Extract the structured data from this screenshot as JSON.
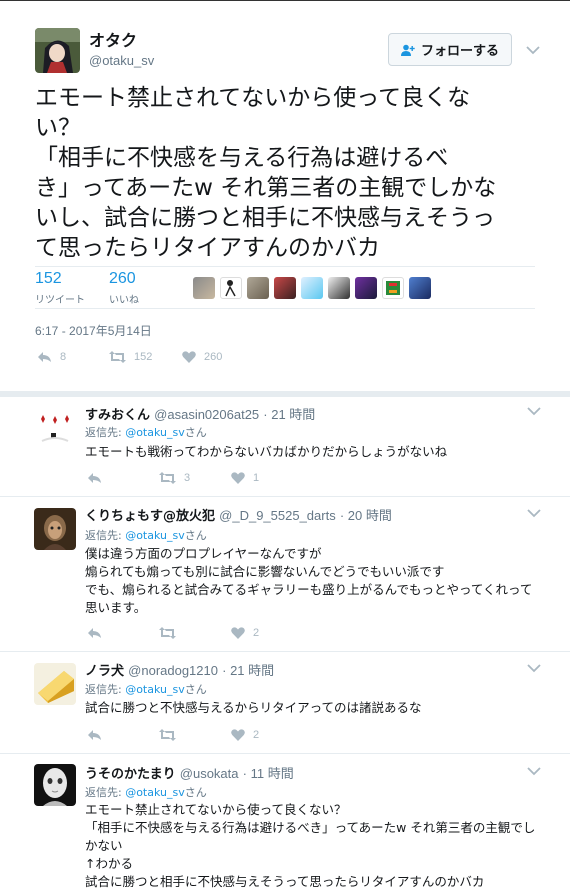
{
  "tweet": {
    "name": "オタク",
    "handle": "@otaku_sv",
    "follow_label": "フォローする",
    "text": "エモート禁止されてないから使って良くな\nい？\n「相手に不快感を与える行為は避けるべ\nき」ってあーたw それ第三者の主観でしかな\nいし、試合に勝つと相手に不快感与えそうっ\nて思ったらリタイアすんのかバカ",
    "retweets": "152",
    "retweets_label": "リツイート",
    "likes": "260",
    "likes_label": "いいね",
    "timestamp": "6:17 - 2017年5月14日",
    "action_reply": "8",
    "action_retweet": "152",
    "action_like": "260"
  },
  "replies": [
    {
      "name": "すみおくん",
      "handle": "@asasin0206at25",
      "time": "· 21 時間",
      "to_prefix": "返信先: ",
      "to_link": "@otaku_sv",
      "to_suffix": "さん",
      "text": "エモートも戦術ってわからないバカばかりだからしょうがないね",
      "retweets": "3",
      "likes": "1"
    },
    {
      "name": "くりちょもす@放火犯",
      "handle": "@_D_9_5525_darts",
      "time": "· 20 時間",
      "to_prefix": "返信先: ",
      "to_link": "@otaku_sv",
      "to_suffix": "さん",
      "text": "僕は違う方面のプロプレイヤーなんですが\n煽られても煽っても別に試合に影響ないんでどうでもいい派です\nでも、煽られると試合みてるギャラリーも盛り上がるんでもっとやってくれって\n思います。",
      "retweets": "",
      "likes": "2"
    },
    {
      "name": "ノラ犬",
      "handle": "@noradog1210",
      "time": "· 21 時間",
      "to_prefix": "返信先: ",
      "to_link": "@otaku_sv",
      "to_suffix": "さん",
      "text": "試合に勝つと不快感与えるからリタイアってのは諸説あるな",
      "retweets": "",
      "likes": "2"
    },
    {
      "name": "うそのかたまり",
      "handle": "@usokata",
      "time": "· 11 時間",
      "to_prefix": "返信先: ",
      "to_link": "@otaku_sv",
      "to_suffix": "さん",
      "text": "エモート禁止されてないから使って良くない？\n「相手に不快感を与える行為は避けるべき」ってあーたw それ第三者の主観でし\nかない\n↑わかる\n試合に勝つと相手に不快感与えそうって思ったらリタイアすんのかバカ"
    }
  ],
  "colors": {
    "link": "#1b95e0",
    "muted": "#657786",
    "icon": "#aab8c2",
    "border": "#e6ecf0"
  }
}
